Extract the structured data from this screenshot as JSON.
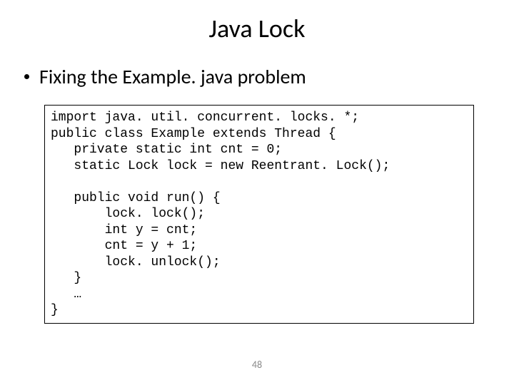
{
  "title": "Java Lock",
  "bullet": "Fixing the Example. java problem",
  "code": {
    "l1": "import java. util. concurrent. locks. *;",
    "l2": "public class Example extends Thread {",
    "l3": "   private static int cnt = 0;",
    "l4": "   static Lock lock = new Reentrant. Lock();",
    "l5": "",
    "l6": "   public void run() {",
    "l7": "       lock. lock();",
    "l8": "       int y = cnt;",
    "l9": "       cnt = y + 1;",
    "l10": "       lock. unlock();",
    "l11": "   }",
    "l12": "   …",
    "l13": "}"
  },
  "page_number": "48"
}
